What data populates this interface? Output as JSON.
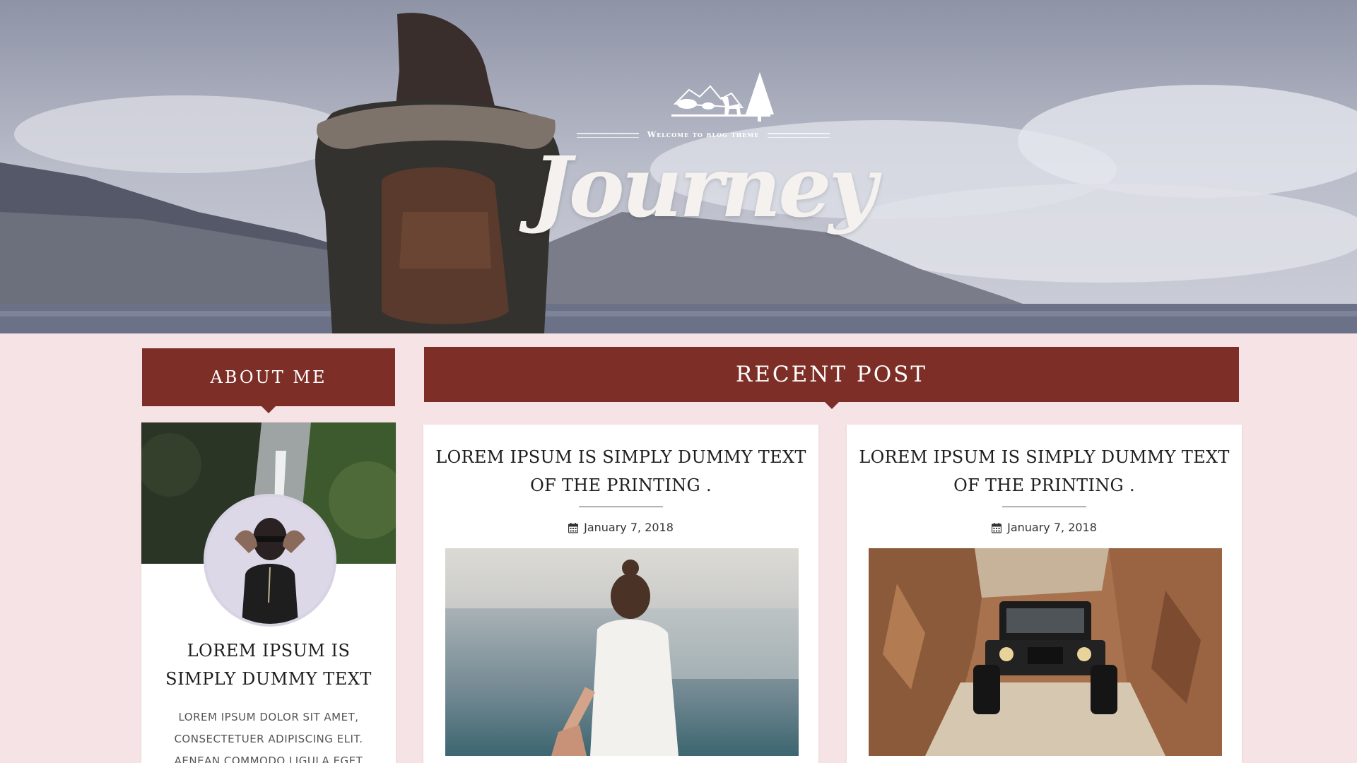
{
  "hero": {
    "tagline": "Welcome to blog theme",
    "title": "Journey"
  },
  "sections": {
    "about_label": "ABOUT ME",
    "recent_label": "RECENT POST"
  },
  "about": {
    "title_lines": [
      "LOREM IPSUM IS",
      "SIMPLY DUMMY TEXT"
    ],
    "text_lines": [
      "LOREM IPSUM DOLOR SIT AMET,",
      "CONSECTETUER ADIPISCING ELIT.",
      "AENEAN COMMODO LIGULA EGET"
    ]
  },
  "posts": [
    {
      "title_lines": [
        "LOREM IPSUM IS SIMPLY DUMMY TEXT",
        "OF THE PRINTING ."
      ],
      "date": "January 7, 2018",
      "image_icon": "sea-photo-icon"
    },
    {
      "title_lines": [
        "LOREM IPSUM IS SIMPLY DUMMY TEXT",
        "OF THE PRINTING ."
      ],
      "date": "January 7, 2018",
      "image_icon": "jeep-photo-icon"
    }
  ],
  "colors": {
    "accent": "#7d2e27",
    "page_background": "#f6e3e5",
    "card_background": "#ffffff"
  }
}
